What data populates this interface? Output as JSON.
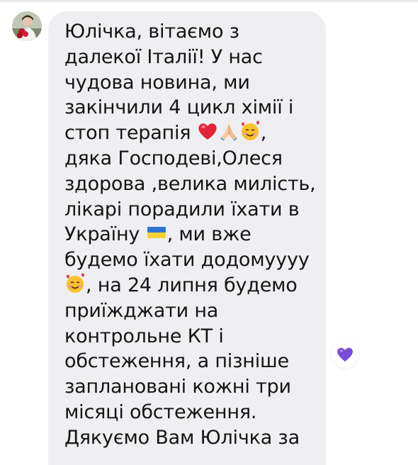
{
  "message": {
    "lines": [
      "Юлічка, вітаємо з",
      "далекої Італії! У нас",
      "чудова новина, ми",
      "закінчили 4 цикл хімії і",
      "стоп терапія",
      ", дяка Господеві,Олеся",
      "здорова ,велика милість,",
      "лікарі порадили їхати в",
      "Україну",
      ", ми вже",
      "будемо їхати додомуууу",
      ", на 24 липня будемо",
      "приїжджати на",
      "контрольне КТ і",
      "обстеження, а пізніше",
      "заплановані кожні три",
      "місяці обстеження.",
      "Дякуємо Вам Юлічка за"
    ],
    "line5_tail": ",",
    "line6_text": "дяка Господеві,Олеся"
  },
  "icons": {
    "avatar": "sender-avatar-photo",
    "heart": "red-heart-emoji",
    "pray": "folded-hands-emoji",
    "smile": "smiling-face-with-hearts-emoji",
    "flag": "ukraine-flag-emoji",
    "reaction": "purple-heart-reaction"
  },
  "colors": {
    "bubble": "#efeff2",
    "text": "#141414",
    "reaction_heart": "#7a4ad8"
  }
}
